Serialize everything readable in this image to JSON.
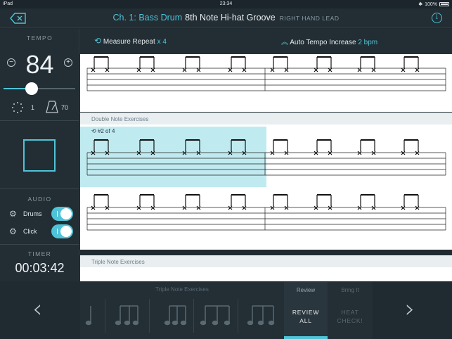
{
  "status_bar": {
    "device": "iPad",
    "time": "23:34",
    "battery": "100%"
  },
  "header": {
    "chapter": "Ch. 1: Bass Drum",
    "exercise": "8th Note Hi-hat Groove",
    "subtitle": "RIGHT HAND LEAD",
    "info_icon": "info-icon",
    "back_icon": "delete-back-icon"
  },
  "tempo": {
    "label": "TEMPO",
    "value": "84",
    "slider_fraction": 0.3,
    "count_in": "1",
    "metronome_value": "70"
  },
  "audio": {
    "label": "AUDIO",
    "items": [
      {
        "label": "Drums",
        "on": true,
        "toggle_text": "I"
      },
      {
        "label": "Click",
        "on": true,
        "toggle_text": "I"
      }
    ]
  },
  "timer": {
    "label": "TIMER",
    "value": "00:03:42"
  },
  "toolbar": {
    "repeat_label": "Measure Repeat",
    "repeat_count": "x 4",
    "auto_tempo_label": "Auto Tempo Increase",
    "auto_tempo_value": "2 bpm"
  },
  "score": {
    "section2_title": "Double Note Exercises",
    "repeat_badge": "#2 of 4",
    "section3_title": "Triple Note Exercises"
  },
  "bottom": {
    "tray_label": "Triple Note Exercises",
    "review_top": "Review",
    "review_main_1": "REVIEW",
    "review_main_2": "ALL",
    "bring_top": "Bring It",
    "bring_main_1": "HEAT",
    "bring_main_2": "CHECK!"
  },
  "colors": {
    "accent": "#4fc3d7",
    "background": "#1f2a31",
    "highlight": "#bfeaf0"
  }
}
